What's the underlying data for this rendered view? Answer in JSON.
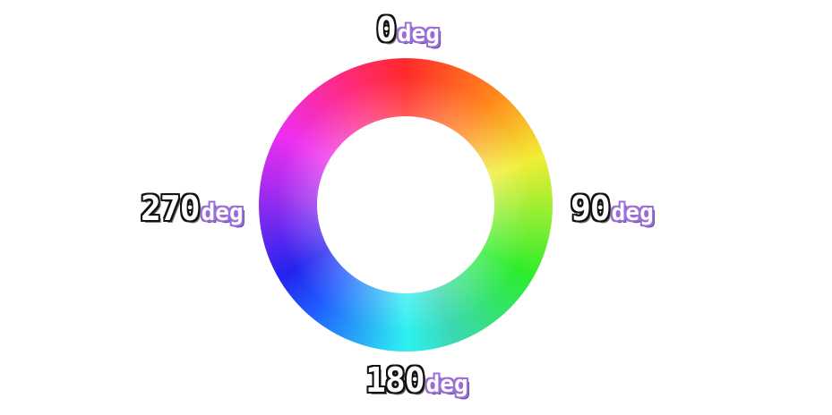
{
  "hue_wheel": {
    "colors": {
      "red": "#ff2a2a",
      "orange": "#ff8a1c",
      "yellow": "#f1ee35",
      "green": "#2ded2d",
      "cyan": "#2ef0f0",
      "blue": "#2323ee",
      "magenta": "#ef2ff0",
      "unit_color": "#9a6fd8"
    },
    "labels": {
      "top": {
        "number": "0",
        "unit": "deg"
      },
      "right": {
        "number": "90",
        "unit": "deg"
      },
      "bottom": {
        "number": "180",
        "unit": "deg"
      },
      "left": {
        "number": "270",
        "unit": "deg"
      }
    }
  }
}
